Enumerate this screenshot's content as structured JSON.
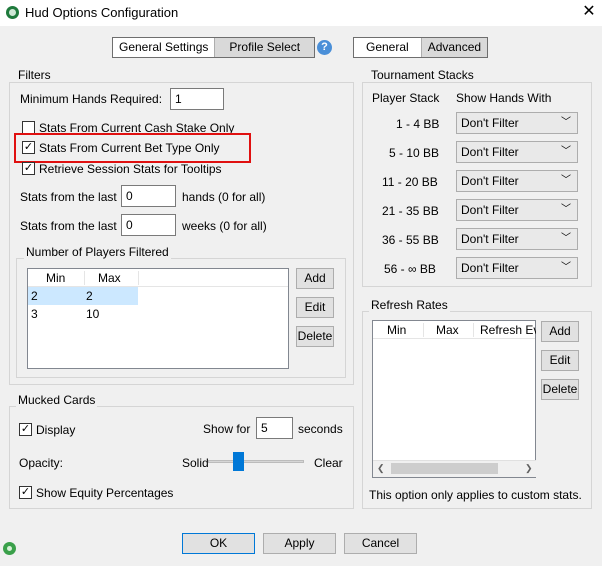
{
  "window": {
    "title": "Hud Options Configuration",
    "close_glyph": "✕",
    "app_icon": "poker-chip-icon",
    "status_icon": "green-status-icon"
  },
  "top_tabs": {
    "left": [
      "General Settings",
      "Profile Select"
    ],
    "help_glyph": "?",
    "right": [
      "General",
      "Advanced"
    ]
  },
  "filters": {
    "title": "Filters",
    "min_hands_label": "Minimum Hands Required:",
    "min_hands_value": "1",
    "check1": "Stats From Current Cash Stake Only",
    "check1_checked": false,
    "check2": "Stats From Current Bet Type Only",
    "check2_checked": true,
    "check3": "Retrieve Session Stats for Tooltips",
    "check3_checked": true,
    "hands_prefix": "Stats from the last",
    "hands_value": "0",
    "hands_suffix": "hands (0 for all)",
    "weeks_prefix": "Stats from the last",
    "weeks_value": "0",
    "weeks_suffix": "weeks (0 for all)",
    "highlight_color": "#e01010"
  },
  "players": {
    "title": "Number of Players Filtered",
    "columns": [
      "Min",
      "Max"
    ],
    "rows": [
      {
        "min": "2",
        "max": "2"
      },
      {
        "min": "3",
        "max": "10"
      }
    ],
    "add": "Add",
    "edit": "Edit",
    "delete": "Delete"
  },
  "mucked": {
    "title": "Mucked Cards",
    "display": "Display",
    "display_checked": true,
    "show_for": "Show for",
    "show_value": "5",
    "seconds": "seconds",
    "opacity": "Opacity:",
    "solid": "Solid",
    "clear": "Clear",
    "equity": "Show Equity Percentages",
    "equity_checked": true
  },
  "tournament": {
    "title": "Tournament Stacks",
    "col_stack": "Player Stack",
    "col_show": "Show Hands With",
    "rows": [
      {
        "stack": "1 - 4 BB",
        "value": "Don't Filter"
      },
      {
        "stack": "5 - 10 BB",
        "value": "Don't Filter"
      },
      {
        "stack": "11 - 20 BB",
        "value": "Don't Filter"
      },
      {
        "stack": "21 - 35 BB",
        "value": "Don't Filter"
      },
      {
        "stack": "36 - 55 BB",
        "value": "Don't Filter"
      },
      {
        "stack": "56 - ∞ BB",
        "value": "Don't Filter"
      }
    ]
  },
  "refresh": {
    "title": "Refresh Rates",
    "columns": [
      "Min",
      "Max",
      "Refresh Ev"
    ],
    "add": "Add",
    "edit": "Edit",
    "delete": "Delete",
    "note": "This option only applies to custom stats."
  },
  "footer": {
    "ok": "OK",
    "apply": "Apply",
    "cancel": "Cancel"
  }
}
